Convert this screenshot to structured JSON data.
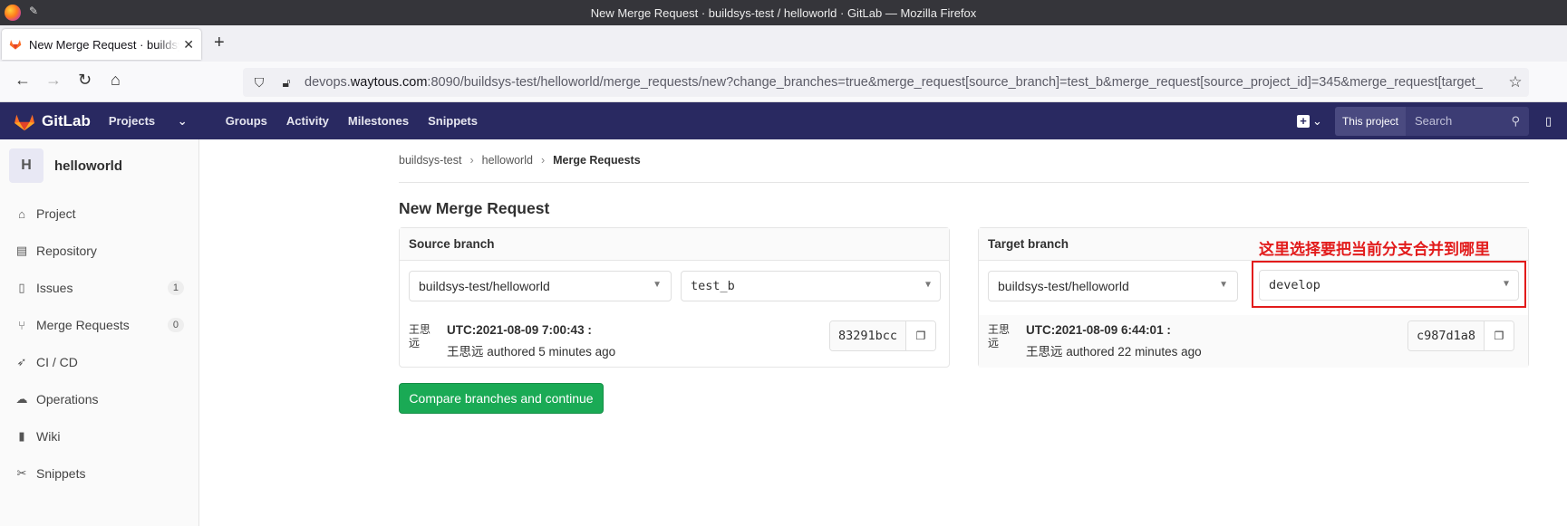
{
  "window": {
    "title": "New Merge Request · buildsys-test / helloworld · GitLab — Mozilla Firefox"
  },
  "browser": {
    "tab_title": "New Merge Request · buildsys-test / helloworld · GitLab",
    "url_prefix": "devops.",
    "url_host": "waytous.com",
    "url_rest": ":8090/buildsys-test/helloworld/merge_requests/new?change_branches=true&merge_request[source_branch]=test_b&merge_request[source_project_id]=345&merge_request[target_"
  },
  "gitlab": {
    "brand": "GitLab",
    "nav": [
      "Projects",
      "Groups",
      "Activity",
      "Milestones",
      "Snippets"
    ],
    "search_scope": "This project",
    "search_placeholder": "Search"
  },
  "sidebar": {
    "avatar_letter": "H",
    "project_name": "helloworld",
    "items": [
      {
        "label": "Project",
        "icon": "home-icon"
      },
      {
        "label": "Repository",
        "icon": "doc-icon"
      },
      {
        "label": "Issues",
        "icon": "issues-icon",
        "count": "1"
      },
      {
        "label": "Merge Requests",
        "icon": "merge-icon",
        "count": "0"
      },
      {
        "label": "CI / CD",
        "icon": "rocket-icon"
      },
      {
        "label": "Operations",
        "icon": "cloud-icon"
      },
      {
        "label": "Wiki",
        "icon": "book-icon"
      },
      {
        "label": "Snippets",
        "icon": "scissors-icon"
      }
    ]
  },
  "breadcrumb": [
    "buildsys-test",
    "helloworld",
    "Merge Requests"
  ],
  "page_title": "New Merge Request",
  "source": {
    "heading": "Source branch",
    "project": "buildsys-test/helloworld",
    "branch": "test_b",
    "avatar_text": "王思远",
    "commit_title": "UTC:2021-08-09 7:00:43 :",
    "commit_author": "王思远 authored 5 minutes ago",
    "sha": "83291bcc"
  },
  "target": {
    "heading": "Target branch",
    "project": "buildsys-test/helloworld",
    "branch": "develop",
    "avatar_text": "王思远",
    "commit_title": "UTC:2021-08-09 6:44:01 :",
    "commit_author": "王思远 authored 22 minutes ago",
    "sha": "c987d1a8"
  },
  "annotation": "这里选择要把当前分支合并到哪里",
  "compare_button": "Compare branches and continue",
  "colors": {
    "header": "#292961",
    "button": "#1aaa55",
    "annotation": "#e21b1b"
  }
}
